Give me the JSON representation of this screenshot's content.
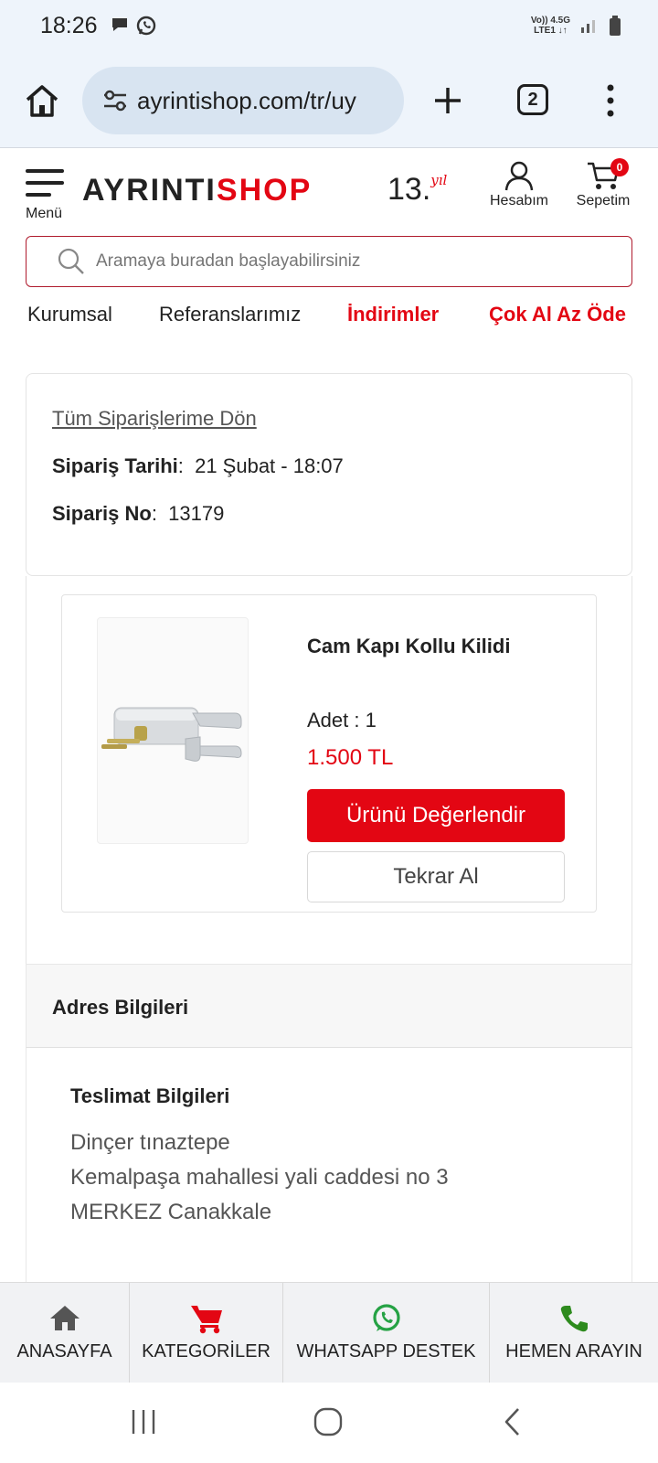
{
  "status_bar": {
    "time": "18:26",
    "network": {
      "line1": "Vo)) 4.5G",
      "line2": "LTE1 ↓↑"
    },
    "icons": [
      "chat-icon",
      "whatsapp-icon",
      "signal-icon",
      "battery-icon"
    ]
  },
  "browser": {
    "url": "ayrintishop.com/tr/uy",
    "tab_count": "2",
    "icons": [
      "home-icon",
      "tune-icon",
      "plus-icon",
      "more-vert-icon"
    ]
  },
  "header": {
    "menu_label": "Menü",
    "logo_part1": "AYRINTI",
    "logo_part2": "SHOP",
    "years": "13.",
    "years_suffix": "yıl",
    "account_label": "Hesabım",
    "cart_label": "Sepetim",
    "cart_count": "0"
  },
  "search": {
    "placeholder": "Aramaya buradan başlayabilirsiniz"
  },
  "nav": {
    "items": [
      "Kurumsal",
      "Referanslarımız",
      "İndirimler",
      "Çok Al Az Öde"
    ]
  },
  "order": {
    "back_link": "Tüm Siparişlerime Dön",
    "date_label": "Sipariş Tarihi",
    "date_value": "21 Şubat - 18:07",
    "number_label": "Sipariş No",
    "number_value": "13179"
  },
  "product": {
    "name": "Cam Kapı Kollu Kilidi",
    "quantity": "Adet : 1",
    "price": "1.500 TL",
    "rate_button": "Ürünü Değerlendir",
    "reorder_button": "Tekrar Al"
  },
  "address": {
    "section_title": "Adres Bilgileri",
    "delivery_title": "Teslimat Bilgileri",
    "name": "Dinçer tınaztepe",
    "street": "Kemalpaşa mahallesi yali caddesi no 3",
    "city": "MERKEZ Canakkale"
  },
  "bottom_bar": {
    "items": [
      {
        "label": "ANASAYFA",
        "icon": "home-icon",
        "color": "#555555"
      },
      {
        "label": "KATEGORİLER",
        "icon": "cart-icon",
        "color": "#e30613"
      },
      {
        "label": "WHATSAPP DESTEK",
        "icon": "whatsapp-icon",
        "color": "#25a244"
      },
      {
        "label": "HEMEN ARAYIN",
        "icon": "phone-icon",
        "color": "#2e8b1e"
      }
    ]
  },
  "colors": {
    "brand_red": "#e30613",
    "browser_bg": "#eef4fb",
    "url_pill": "#d8e4f1"
  }
}
